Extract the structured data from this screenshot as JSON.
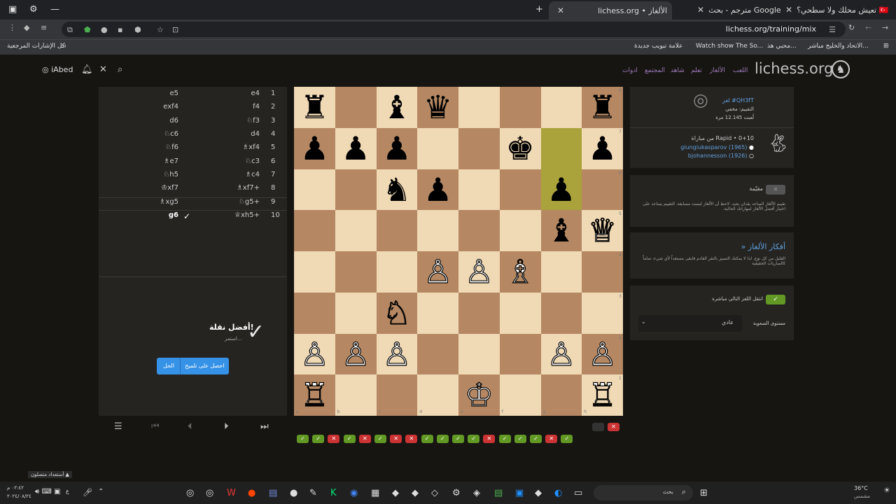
{
  "browser": {
    "tabs": [
      {
        "title": "تعيش محلك ولا سطحي؟ 🇹🇷"
      },
      {
        "title": "مترجم - بحث Google"
      },
      {
        "title": "lichess.org • الألغاز"
      }
    ],
    "url": "lichess.org/training/mix",
    "bookmarks": [
      {
        "label": "الاتحاد والخليج مباشر..."
      },
      {
        "label": "محبي هذ..."
      },
      {
        "label": "Watch show The So..."
      },
      {
        "label": "علامة تبويب جديدة"
      },
      {
        "label": "كل الإشارات المرجعية"
      }
    ]
  },
  "site": {
    "logo": "lichess.org",
    "nav": [
      "اللعب",
      "الألغاز",
      "تعلم",
      "شاهد",
      "المجتمع",
      "ادوات"
    ],
    "user": "iAbed"
  },
  "moves": [
    {
      "n": "1",
      "w": "e4",
      "b": "e5"
    },
    {
      "n": "2",
      "w": "f4",
      "b": "exf4"
    },
    {
      "n": "3",
      "w": "♘f3",
      "b": "d6"
    },
    {
      "n": "4",
      "w": "d4",
      "b": "♘c6"
    },
    {
      "n": "5",
      "w": "♗xf4",
      "b": "♘f6"
    },
    {
      "n": "6",
      "w": "♘c3",
      "b": "♗e7"
    },
    {
      "n": "7",
      "w": "♗c4",
      "b": "♘h5"
    },
    {
      "n": "8",
      "w": "♗xf7+",
      "b": "♔xf7"
    },
    {
      "n": "9",
      "w": "♘g5+",
      "b": "♗xg5"
    },
    {
      "n": "10",
      "w": "♕xh5+",
      "b": "g6"
    }
  ],
  "feedback": {
    "title": "أفضل نقلة!",
    "subtitle": "استمر...",
    "hint_button": "احصل على تلميح",
    "solution_button": "الحل"
  },
  "board": {
    "files": [
      "a",
      "b",
      "c",
      "d",
      "e",
      "f",
      "g",
      "h"
    ],
    "ranks": [
      "8",
      "7",
      "6",
      "5",
      "4",
      "3",
      "2",
      "1"
    ],
    "pieces": [
      {
        "sq": "a8",
        "glyph": "♜",
        "color": "b"
      },
      {
        "sq": "c8",
        "glyph": "♝",
        "color": "b"
      },
      {
        "sq": "d8",
        "glyph": "♛",
        "color": "b"
      },
      {
        "sq": "h8",
        "glyph": "♜",
        "color": "b"
      },
      {
        "sq": "a7",
        "glyph": "♟",
        "color": "b"
      },
      {
        "sq": "b7",
        "glyph": "♟",
        "color": "b"
      },
      {
        "sq": "c7",
        "glyph": "♟",
        "color": "b"
      },
      {
        "sq": "f7",
        "glyph": "♚",
        "color": "b"
      },
      {
        "sq": "h7",
        "glyph": "♟",
        "color": "b"
      },
      {
        "sq": "c6",
        "glyph": "♞",
        "color": "b"
      },
      {
        "sq": "d6",
        "glyph": "♟",
        "color": "b"
      },
      {
        "sq": "g6",
        "glyph": "♟",
        "color": "b"
      },
      {
        "sq": "g5",
        "glyph": "♝",
        "color": "b"
      },
      {
        "sq": "h5",
        "glyph": "♕",
        "color": "w"
      },
      {
        "sq": "d4",
        "glyph": "♙",
        "color": "w"
      },
      {
        "sq": "e4",
        "glyph": "♙",
        "color": "w"
      },
      {
        "sq": "f4",
        "glyph": "♗",
        "color": "w"
      },
      {
        "sq": "c3",
        "glyph": "♘",
        "color": "w"
      },
      {
        "sq": "a2",
        "glyph": "♙",
        "color": "w"
      },
      {
        "sq": "b2",
        "glyph": "♙",
        "color": "w"
      },
      {
        "sq": "c2",
        "glyph": "♙",
        "color": "w"
      },
      {
        "sq": "g2",
        "glyph": "♙",
        "color": "w"
      },
      {
        "sq": "h2",
        "glyph": "♙",
        "color": "w"
      },
      {
        "sq": "a1",
        "glyph": "♖",
        "color": "w"
      },
      {
        "sq": "e1",
        "glyph": "♔",
        "color": "w"
      },
      {
        "sq": "h1",
        "glyph": "♖",
        "color": "w"
      }
    ],
    "highlight": [
      "g7",
      "g6"
    ],
    "highlight_color": "#aaa23a"
  },
  "results": [
    "ok",
    "ok",
    "bad",
    "ok",
    "bad",
    "ok",
    "bad",
    "bad",
    "ok",
    "ok",
    "ok",
    "ok",
    "bad",
    "ok",
    "ok",
    "ok",
    "bad",
    "ok"
  ],
  "results_top": [
    "none",
    "bad"
  ],
  "puzzle_info": {
    "id": "لغز #QH3fT",
    "rating": "التقييم: مخفي",
    "played": "لُعبت 12.145 مرة",
    "from_game": "من مباراة Rapid • 0+10",
    "player_white": "giungiukasparov (1965)",
    "player_black": "bjohannesson (1926)"
  },
  "difficulty_card": {
    "toggle_label": "مقيّمة",
    "description": "تقييم الألغاز الصاعد يقدان بجيد. لاحظ أن الألغاز ليست مسابقة. التقييم يساعد على اختيار أفضل الألغاز لمهاراتك الحالية."
  },
  "themes_card": {
    "title": "» أفكار الألغاز",
    "text": "القليل من كل نوع. لذا لا يمكنك التمييز بالنقر القادم فابقى مستعداً لأي شيء، تماماً كالمباريات الحقيقية"
  },
  "settings_card": {
    "auto_next": "انتقل اللغز التالي مباشرة",
    "difficulty_label": "مستوى الصعوبة",
    "difficulty_value": "عادي"
  },
  "misc": {
    "notif": "أستعداد متصلون"
  },
  "taskbar": {
    "weather": "36°C",
    "weather_sub": "مشمس",
    "search": "بحث",
    "time": "٠٢:٤٢ م",
    "date": "٢٠٢٤/٠٨/٢٤",
    "lang": "ع"
  }
}
